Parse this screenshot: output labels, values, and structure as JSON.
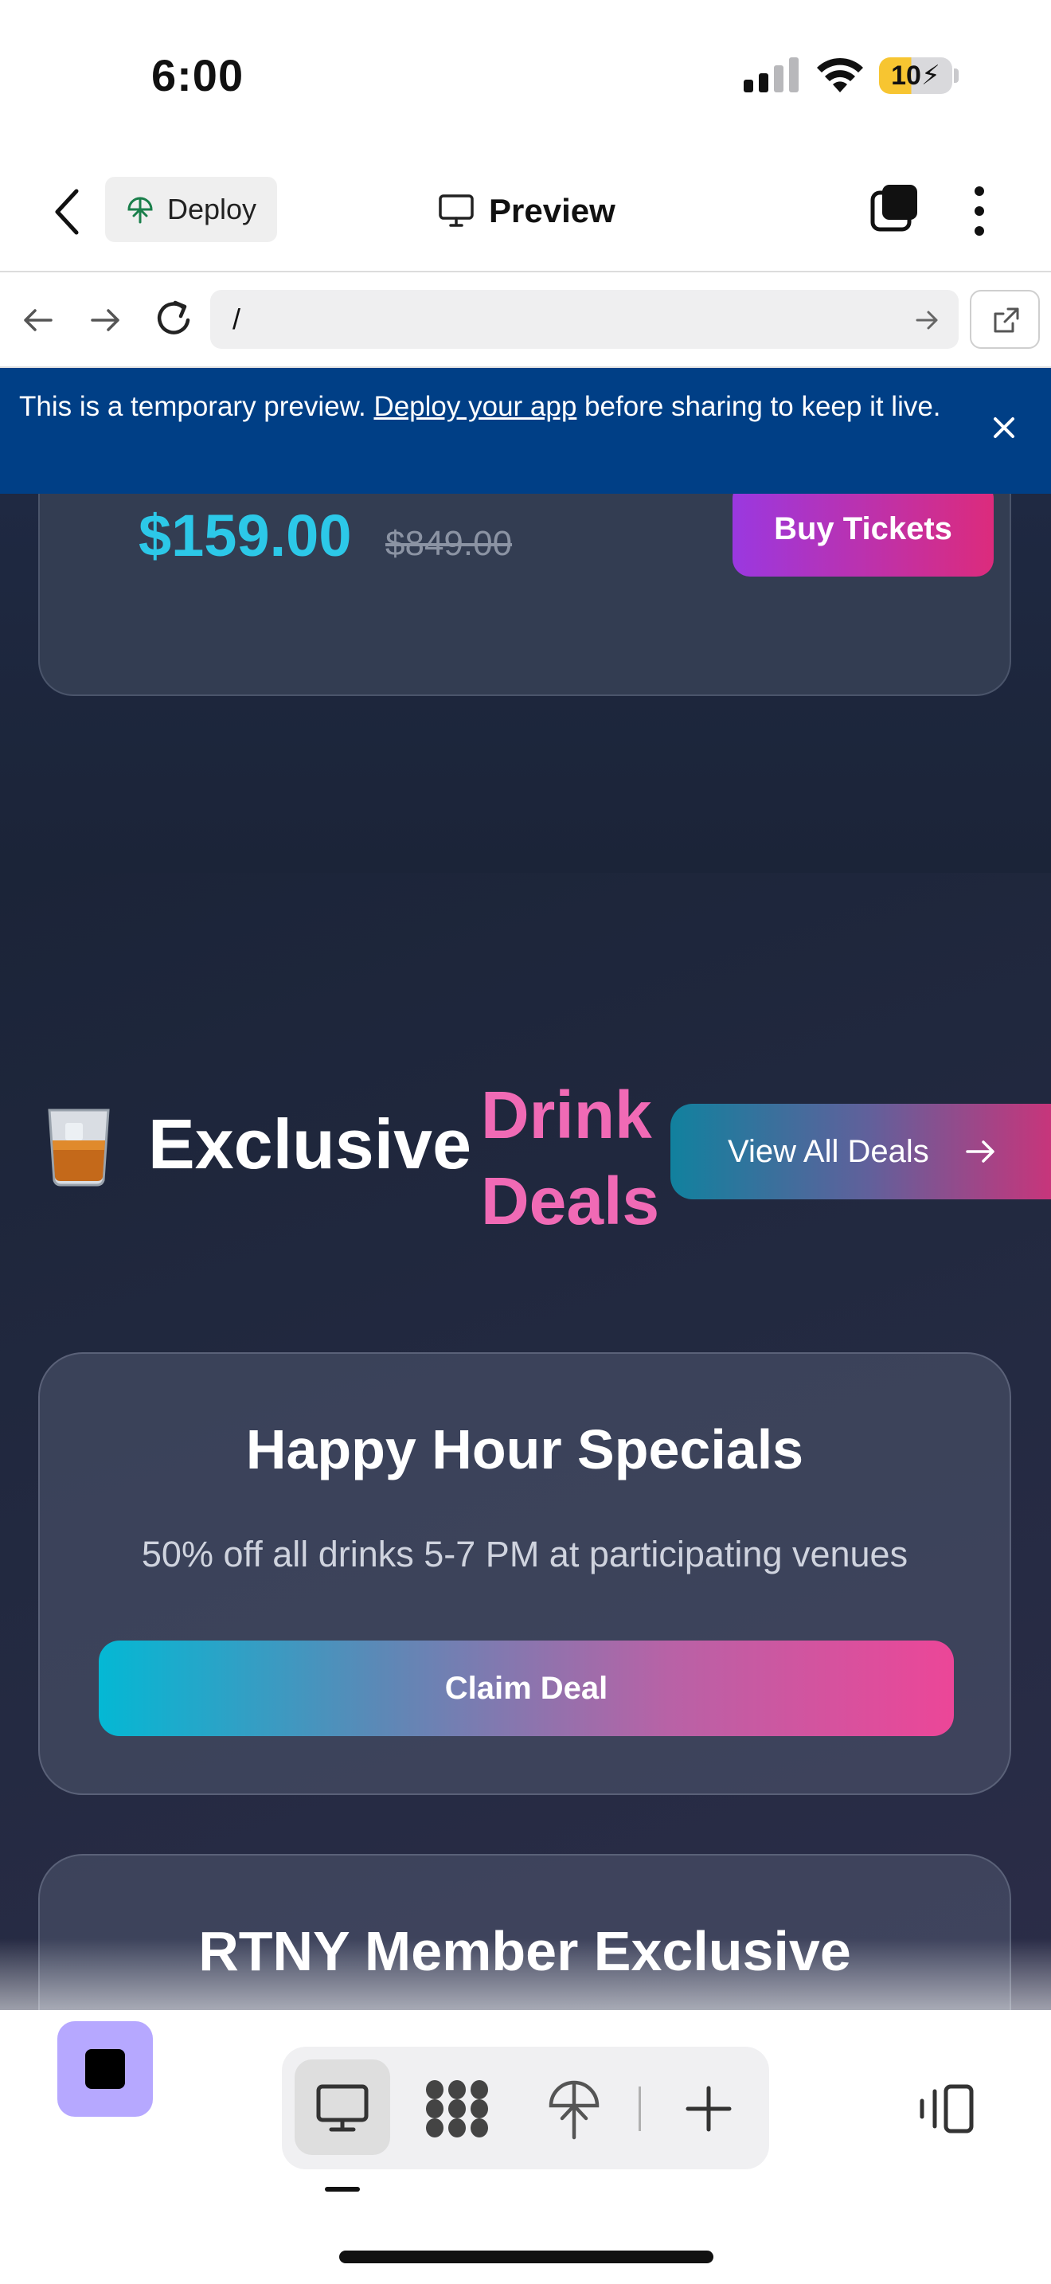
{
  "status_bar": {
    "time": "6:00",
    "battery": "10"
  },
  "header": {
    "deploy_label": "Deploy",
    "title": "Preview"
  },
  "browser": {
    "url": "/"
  },
  "banner": {
    "text_before": "This is a temporary preview. ",
    "link": "Deploy your app",
    "text_after": " before sharing to keep it live."
  },
  "webpage": {
    "previous_card": {
      "price": "$159.00",
      "original_price": "$849.00",
      "button": "Buy Tickets"
    },
    "deals_section": {
      "emoji": "🥃",
      "title_main": "Exclusive",
      "title_accent_line1": "Drink",
      "title_accent_line2": "Deals",
      "view_all": "View All Deals",
      "cards": [
        {
          "title": "Happy Hour Specials",
          "description": "50% off all drinks 5-7 PM at participating venues",
          "button": "Claim Deal"
        },
        {
          "title": "RTNY Member Exclusive"
        }
      ]
    }
  },
  "colors": {
    "banner_bg": "#003f86",
    "price_cyan": "#2cc8e8",
    "accent_pink": "#f06ab5",
    "stop_button": "#b6a8ff"
  },
  "icons": [
    "back-icon",
    "deploy-icon",
    "monitor-icon",
    "tabs-icon",
    "more-icon",
    "arrow-left-icon",
    "arrow-right-icon",
    "reload-icon",
    "external-link-icon",
    "close-icon",
    "apps-icon",
    "add-icon",
    "panel-toggle-icon"
  ]
}
